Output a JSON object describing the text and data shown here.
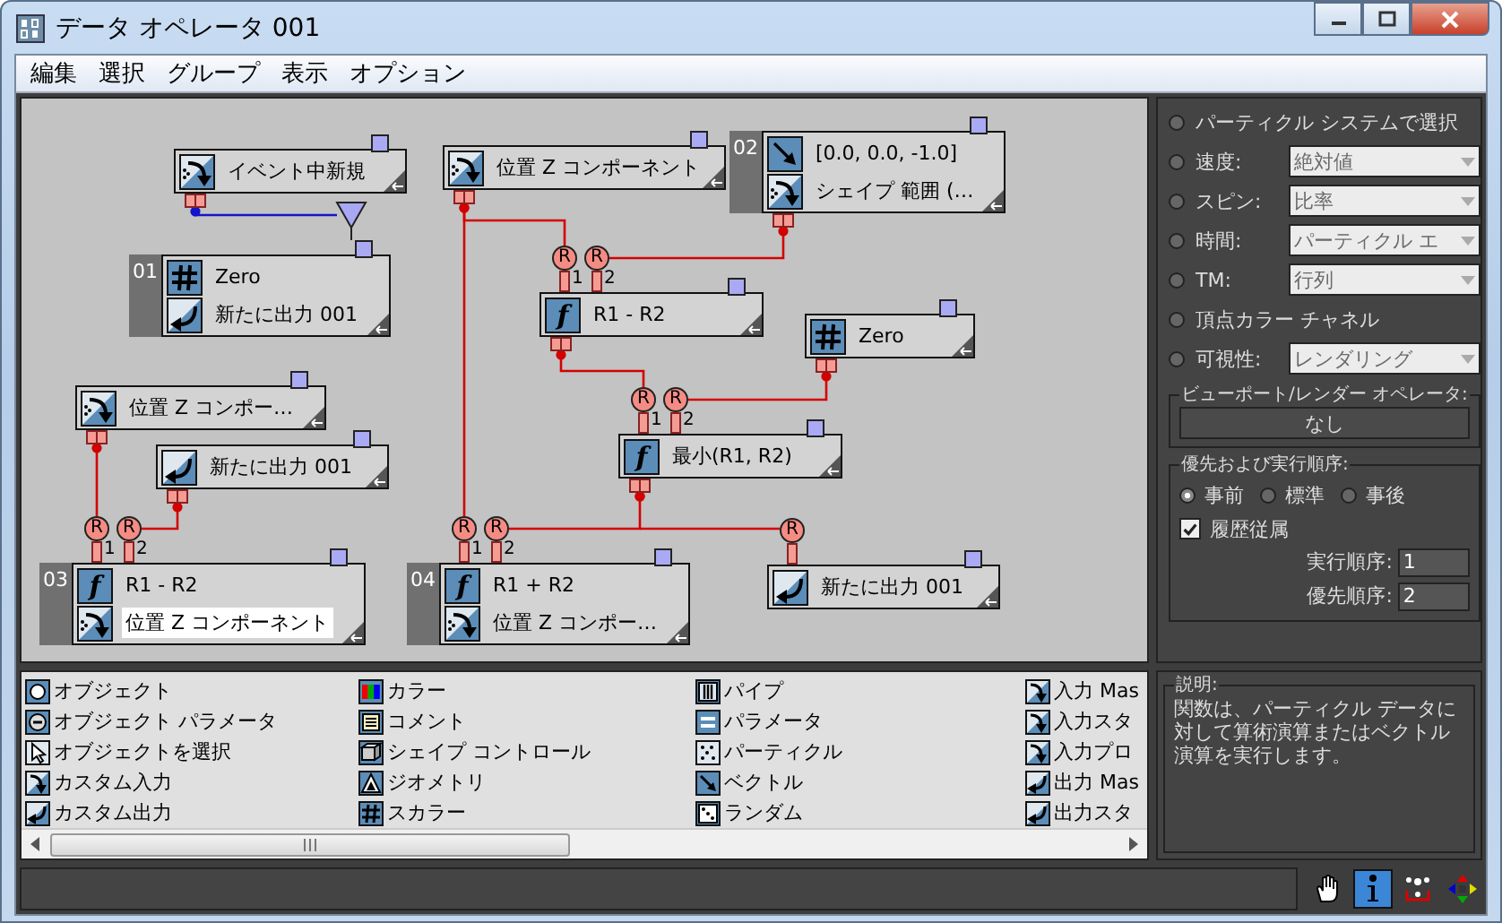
{
  "window": {
    "title": "データ オペレータ 001"
  },
  "menu": [
    "編集",
    "選択",
    "グループ",
    "表示",
    "オプション"
  ],
  "canvas": {
    "nodes": [
      {
        "rows": [
          {
            "kind": "input",
            "text": "イベント中新規",
            "highlighted": false
          }
        ]
      },
      {
        "rows": [
          {
            "kind": "input",
            "text": "位置 Z コンポーネント",
            "highlighted": false
          }
        ]
      },
      {
        "number": "02",
        "rows": [
          {
            "kind": "vector",
            "text": "[0.0, 0.0, -1.0]",
            "highlighted": false
          },
          {
            "kind": "input",
            "text": "シェイプ 範囲 (…",
            "highlighted": false
          }
        ]
      },
      {
        "number": "01",
        "rows": [
          {
            "kind": "scalar",
            "text": "Zero",
            "highlighted": false
          },
          {
            "kind": "output",
            "text": "新たに出力 001",
            "highlighted": false
          }
        ]
      },
      {
        "inputs": [
          {
            "badge": "R",
            "label": "1"
          },
          {
            "badge": "R",
            "label": "2"
          }
        ],
        "rows": [
          {
            "kind": "function",
            "glyph": "f",
            "text": "R1 - R2",
            "highlighted": false
          }
        ]
      },
      {
        "rows": [
          {
            "kind": "scalar",
            "text": "Zero",
            "highlighted": false
          }
        ]
      },
      {
        "rows": [
          {
            "kind": "input",
            "text": "位置 Z コンポー…",
            "highlighted": false
          }
        ]
      },
      {
        "rows": [
          {
            "kind": "output",
            "text": "新たに出力 001",
            "highlighted": false
          }
        ]
      },
      {
        "inputs": [
          {
            "badge": "R",
            "label": "1"
          },
          {
            "badge": "R",
            "label": "2"
          }
        ],
        "rows": [
          {
            "kind": "function",
            "glyph": "f",
            "text": "最小(R1, R2)",
            "highlighted": false
          }
        ]
      },
      {
        "number": "03",
        "inputs": [
          {
            "badge": "R",
            "label": "1"
          },
          {
            "badge": "R",
            "label": "2"
          }
        ],
        "rows": [
          {
            "kind": "function",
            "glyph": "f",
            "text": "R1 - R2",
            "highlighted": false
          },
          {
            "kind": "input",
            "text": "位置 Z コンポーネント",
            "highlighted": true
          }
        ]
      },
      {
        "number": "04",
        "inputs": [
          {
            "badge": "R",
            "label": "1"
          },
          {
            "badge": "R",
            "label": "2"
          }
        ],
        "rows": [
          {
            "kind": "function",
            "glyph": "f",
            "text": "R1 + R2",
            "highlighted": false
          },
          {
            "kind": "input",
            "text": "位置 Z コンポー…",
            "highlighted": false
          }
        ]
      },
      {
        "inputs": [
          {
            "badge": "R"
          }
        ],
        "rows": [
          {
            "kind": "output",
            "text": "新たに出力 001",
            "highlighted": false
          }
        ]
      }
    ],
    "wires": [
      {
        "color": "#1414c8"
      },
      {
        "color": "#d40000"
      },
      {
        "color": "#d40000"
      },
      {
        "color": "#d40000"
      },
      {
        "color": "#d40000"
      },
      {
        "color": "#d40000"
      },
      {
        "color": "#d40000"
      },
      {
        "color": "#d40000"
      },
      {
        "color": "#d40000"
      },
      {
        "color": "#d40000"
      }
    ]
  },
  "properties": {
    "rows": [
      {
        "kind": "radio",
        "label": "パーティクル システムで選択",
        "selected": false
      },
      {
        "kind": "radio-select",
        "label": "速度:",
        "value": "絶対値",
        "selected": false
      },
      {
        "kind": "radio-select",
        "label": "スピン:",
        "value": "比率",
        "selected": false
      },
      {
        "kind": "radio-select",
        "label": "時間:",
        "value": "パーティクル エ",
        "selected": false
      },
      {
        "kind": "radio-select",
        "label": "TM:",
        "value": "行列",
        "selected": false
      },
      {
        "kind": "radio",
        "label": "頂点カラー チャネル",
        "selected": false
      },
      {
        "kind": "radio-select",
        "label": "可視性:",
        "value": "レンダリング",
        "selected": false
      }
    ],
    "viewport_group": {
      "title": "ビューポート/レンダー オペレータ:",
      "button": "なし"
    },
    "order_group": {
      "title": "優先および実行順序:",
      "options": [
        {
          "label": "事前",
          "selected": true
        },
        {
          "label": "標準",
          "selected": false
        },
        {
          "label": "事後",
          "selected": false
        }
      ],
      "history": {
        "label": "履歴従属",
        "checked": true
      },
      "fields": [
        {
          "label": "実行順序:",
          "value": "1"
        },
        {
          "label": "優先順序:",
          "value": "2"
        }
      ]
    }
  },
  "palette": {
    "columns": [
      [
        {
          "kind": "object",
          "label": "オブジェクト"
        },
        {
          "kind": "object-param",
          "label": "オブジェクト パラメータ"
        },
        {
          "kind": "select",
          "label": "オブジェクトを選択"
        },
        {
          "kind": "input",
          "label": "カスタム入力"
        },
        {
          "kind": "output",
          "label": "カスタム出力"
        }
      ],
      [
        {
          "kind": "color",
          "label": "カラー"
        },
        {
          "kind": "comment",
          "label": "コメント"
        },
        {
          "kind": "shape",
          "label": "シェイプ コントロール"
        },
        {
          "kind": "geometry",
          "label": "ジオメトリ"
        },
        {
          "kind": "scalar",
          "label": "スカラー"
        }
      ],
      [
        {
          "kind": "pipe",
          "label": "パイプ"
        },
        {
          "kind": "param",
          "label": "パラメータ"
        },
        {
          "kind": "particle",
          "label": "パーティクル"
        },
        {
          "kind": "vector",
          "label": "ベクトル"
        },
        {
          "kind": "random",
          "label": "ランダム"
        }
      ],
      [
        {
          "kind": "input",
          "label": "入力 Mas"
        },
        {
          "kind": "input",
          "label": "入力スタ"
        },
        {
          "kind": "input",
          "label": "入力プロ"
        },
        {
          "kind": "output",
          "label": "出力 Mas"
        },
        {
          "kind": "output",
          "label": "出力スタ"
        }
      ]
    ]
  },
  "description": {
    "title": "説明:",
    "text": "関数は、パーティクル データに対して算術演算またはベクトル演算を実行します。"
  },
  "status_bar": {
    "tools": [
      {
        "kind": "hand",
        "selected": false
      },
      {
        "kind": "info",
        "selected": true
      },
      {
        "kind": "numbering",
        "selected": false
      },
      {
        "kind": "move",
        "selected": false
      }
    ]
  }
}
